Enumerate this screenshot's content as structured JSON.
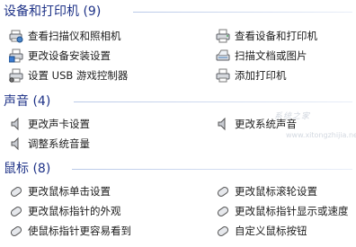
{
  "sections": [
    {
      "title": "设备和打印机 (9)",
      "items": [
        {
          "label": "查看扫描仪和照相机",
          "icon": "printer-camera-icon"
        },
        {
          "label": "查看设备和打印机",
          "icon": "printer-icon"
        },
        {
          "label": "更改设备安装设置",
          "icon": "printer-settings-icon"
        },
        {
          "label": "扫描文档或图片",
          "icon": "scanner-icon"
        },
        {
          "label": "设置 USB 游戏控制器",
          "icon": "gamepad-icon"
        },
        {
          "label": "添加打印机",
          "icon": "add-printer-icon"
        }
      ]
    },
    {
      "title": "声音 (4)",
      "items": [
        {
          "label": "更改声卡设置",
          "icon": "speaker-icon"
        },
        {
          "label": "更改系统声音",
          "icon": "speaker-icon"
        },
        {
          "label": "调整系统音量",
          "icon": "speaker-icon"
        }
      ]
    },
    {
      "title": "鼠标 (8)",
      "items": [
        {
          "label": "更改鼠标单击设置",
          "icon": "mouse-icon"
        },
        {
          "label": "更改鼠标滚轮设置",
          "icon": "mouse-icon"
        },
        {
          "label": "更改鼠标指针的外观",
          "icon": "mouse-icon"
        },
        {
          "label": "更改鼠标指针显示或速度",
          "icon": "mouse-icon"
        },
        {
          "label": "使鼠标指针更容易看到",
          "icon": "mouse-icon"
        },
        {
          "label": "自定义鼠标按钮",
          "icon": "mouse-icon"
        }
      ]
    }
  ],
  "watermark": {
    "text": "系统之家",
    "sub": "www.xitongzhijia.net"
  },
  "colors": {
    "heading": "#1e3287",
    "rule": "#b9c9e8",
    "text": "#1c1c1c"
  }
}
